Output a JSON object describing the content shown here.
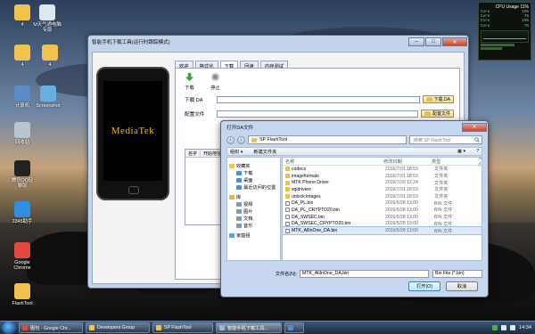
{
  "desktop_icons": [
    {
      "label": "4",
      "name": "desktop-icon-top-left",
      "color": "#f2c14e"
    },
    {
      "label": "M天气通电脑\n专版 ",
      "name": "desktop-icon-weather",
      "color": "#dfe7f0"
    },
    {
      "label": "4",
      "name": "desktop-icon-second-row-left",
      "color": "#f2c14e"
    },
    {
      "label": "4",
      "name": "desktop-icon-second-row-right",
      "color": "#f2c14e"
    },
    {
      "label": "计算机",
      "name": "desktop-icon-computer",
      "color": "#5a8cc9"
    },
    {
      "label": "Screenshot",
      "name": "desktop-icon-screenshot",
      "color": "#66b0e0"
    },
    {
      "label": "回收站",
      "name": "desktop-icon-recycle-bin",
      "color": "#b9c4cf"
    },
    {
      "label": "腾讯QQ轻\n聊版",
      "name": "desktop-icon-qq",
      "color": "#222222"
    },
    {
      "label": "2345助手",
      "name": "desktop-icon-2345",
      "color": "#2f8fe0"
    },
    {
      "label": "Google\nChrome",
      "name": "desktop-icon-chrome",
      "color": "#e2483b"
    },
    {
      "label": "FlashTool",
      "name": "desktop-icon-flashtool",
      "color": "#f2c14e"
    }
  ],
  "gadget": {
    "title": "CPU Usage 11%",
    "rows": [
      [
        "Core",
        "15%"
      ],
      [
        "Core",
        "7%"
      ],
      [
        "Core",
        "15%"
      ],
      [
        "Core",
        "7%"
      ]
    ],
    "accent": "#49d649"
  },
  "flash_window": {
    "title": "智能手机下载工具(运行时跟踪模式)",
    "phone_screen_text": "MediaTek",
    "tabs": [
      "欢迎",
      "格式化",
      "下载",
      "回读",
      "内存测试"
    ],
    "active_tab": 2,
    "toolbar": {
      "download": "下载",
      "stop": "停止"
    },
    "da_label": "下载 DA",
    "da_value": "",
    "da_button": "下载 DA",
    "scatter_label": "配置文件",
    "scatter_value": "",
    "scatter_button": "配置文件",
    "grid_headers": [
      "名字",
      "开始地址",
      "结束"
    ],
    "minimize": "–",
    "maximize": "□",
    "close": "✕"
  },
  "dialog": {
    "title": "打开DA文件",
    "path": "SP FlashTool",
    "search_placeholder": "搜索 SP FlashTool",
    "organize": "组织 ▾",
    "new_folder": "新建文件夹",
    "nav_items": [
      {
        "label": "收藏夹",
        "icon": "star-icon",
        "color": "#f2c14e",
        "group": true
      },
      {
        "label": "下载",
        "icon": "download-folder-icon",
        "color": "#4f8ed8"
      },
      {
        "label": "桌面",
        "icon": "desktop-icon",
        "color": "#4f8ed8"
      },
      {
        "label": "最近访问的位置",
        "icon": "recent-icon",
        "color": "#4f8ed8"
      },
      {
        "label": "库",
        "icon": "library-icon",
        "color": "#e0b54a",
        "group": true
      },
      {
        "label": "视频",
        "icon": "video-icon",
        "color": "#7a9bc3"
      },
      {
        "label": "图片",
        "icon": "picture-icon",
        "color": "#7a9bc3"
      },
      {
        "label": "文档",
        "icon": "document-icon",
        "color": "#7a9bc3"
      },
      {
        "label": "音乐",
        "icon": "music-icon",
        "color": "#7a9bc3"
      },
      {
        "label": "家庭组",
        "icon": "homegroup-icon",
        "color": "#5aa0e0",
        "group": true
      }
    ],
    "columns": [
      "名称",
      "修改日期",
      "类型",
      "大小"
    ],
    "files": [
      {
        "name": "codecs",
        "date": "2016/7/31 18:53",
        "type": "文件夹",
        "kind": "folder"
      },
      {
        "name": "imageformats",
        "date": "2016/7/31 18:53",
        "type": "文件夹",
        "kind": "folder"
      },
      {
        "name": "MTK Phone Driver",
        "date": "2016/7/30 13:24",
        "type": "文件夹",
        "kind": "folder"
      },
      {
        "name": "sqldrivers",
        "date": "2016/7/31 18:53",
        "type": "文件夹",
        "kind": "folder"
      },
      {
        "name": "unlock images",
        "date": "2016/7/31 18:53",
        "type": "文件夹",
        "kind": "folder"
      },
      {
        "name": "DA_PL.bin",
        "date": "2016/5/28 13:00",
        "type": "BIN 文件",
        "kind": "file"
      },
      {
        "name": "DA_PL_CRYPTO20.bin",
        "date": "2016/5/28 13:00",
        "type": "BIN 文件",
        "kind": "file"
      },
      {
        "name": "DA_SWSEC.bin",
        "date": "2016/5/28 13:00",
        "type": "BIN 文件",
        "kind": "file"
      },
      {
        "name": "DA_SWSEC_CRYPTO20.bin",
        "date": "2016/5/28 13:00",
        "type": "BIN 文件",
        "kind": "file"
      },
      {
        "name": "MTK_AllInOne_DA.bin",
        "date": "2016/5/28 13:00",
        "type": "BIN 文件",
        "kind": "file",
        "selected": true
      }
    ],
    "filename_label": "文件名(N):",
    "filename_value": "MTK_AllInOne_DA.bin",
    "filetype_value": "Bin File (*.bin)",
    "open_button": "打开(O)",
    "cancel_button": "取消"
  },
  "taskbar": {
    "tasks": [
      {
        "label": "图包 - Google Chr...",
        "color": "#e2483b"
      },
      {
        "label": "Developers Group",
        "color": "#f2c14e"
      },
      {
        "label": "SP FlashTool",
        "color": "#f2c14e"
      },
      {
        "label": "智能手机下载工具...",
        "color": "#9db4d4",
        "active": true
      },
      {
        "label": "",
        "color": "#5a8cc9"
      }
    ],
    "clock": "14:34"
  }
}
